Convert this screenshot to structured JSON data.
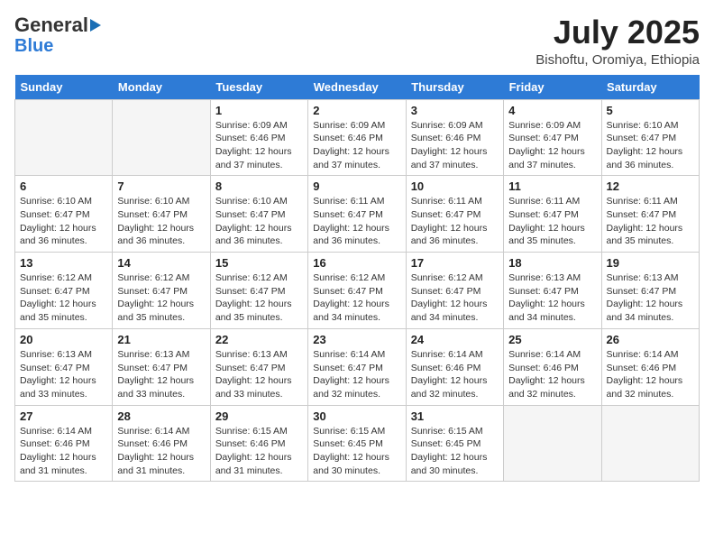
{
  "header": {
    "logo_line1": "General",
    "logo_line2": "Blue",
    "month_year": "July 2025",
    "location": "Bishoftu, Oromiya, Ethiopia"
  },
  "days_of_week": [
    "Sunday",
    "Monday",
    "Tuesday",
    "Wednesday",
    "Thursday",
    "Friday",
    "Saturday"
  ],
  "weeks": [
    [
      {
        "day": "",
        "info": ""
      },
      {
        "day": "",
        "info": ""
      },
      {
        "day": "1",
        "info": "Sunrise: 6:09 AM\nSunset: 6:46 PM\nDaylight: 12 hours and 37 minutes."
      },
      {
        "day": "2",
        "info": "Sunrise: 6:09 AM\nSunset: 6:46 PM\nDaylight: 12 hours and 37 minutes."
      },
      {
        "day": "3",
        "info": "Sunrise: 6:09 AM\nSunset: 6:46 PM\nDaylight: 12 hours and 37 minutes."
      },
      {
        "day": "4",
        "info": "Sunrise: 6:09 AM\nSunset: 6:47 PM\nDaylight: 12 hours and 37 minutes."
      },
      {
        "day": "5",
        "info": "Sunrise: 6:10 AM\nSunset: 6:47 PM\nDaylight: 12 hours and 36 minutes."
      }
    ],
    [
      {
        "day": "6",
        "info": "Sunrise: 6:10 AM\nSunset: 6:47 PM\nDaylight: 12 hours and 36 minutes."
      },
      {
        "day": "7",
        "info": "Sunrise: 6:10 AM\nSunset: 6:47 PM\nDaylight: 12 hours and 36 minutes."
      },
      {
        "day": "8",
        "info": "Sunrise: 6:10 AM\nSunset: 6:47 PM\nDaylight: 12 hours and 36 minutes."
      },
      {
        "day": "9",
        "info": "Sunrise: 6:11 AM\nSunset: 6:47 PM\nDaylight: 12 hours and 36 minutes."
      },
      {
        "day": "10",
        "info": "Sunrise: 6:11 AM\nSunset: 6:47 PM\nDaylight: 12 hours and 36 minutes."
      },
      {
        "day": "11",
        "info": "Sunrise: 6:11 AM\nSunset: 6:47 PM\nDaylight: 12 hours and 35 minutes."
      },
      {
        "day": "12",
        "info": "Sunrise: 6:11 AM\nSunset: 6:47 PM\nDaylight: 12 hours and 35 minutes."
      }
    ],
    [
      {
        "day": "13",
        "info": "Sunrise: 6:12 AM\nSunset: 6:47 PM\nDaylight: 12 hours and 35 minutes."
      },
      {
        "day": "14",
        "info": "Sunrise: 6:12 AM\nSunset: 6:47 PM\nDaylight: 12 hours and 35 minutes."
      },
      {
        "day": "15",
        "info": "Sunrise: 6:12 AM\nSunset: 6:47 PM\nDaylight: 12 hours and 35 minutes."
      },
      {
        "day": "16",
        "info": "Sunrise: 6:12 AM\nSunset: 6:47 PM\nDaylight: 12 hours and 34 minutes."
      },
      {
        "day": "17",
        "info": "Sunrise: 6:12 AM\nSunset: 6:47 PM\nDaylight: 12 hours and 34 minutes."
      },
      {
        "day": "18",
        "info": "Sunrise: 6:13 AM\nSunset: 6:47 PM\nDaylight: 12 hours and 34 minutes."
      },
      {
        "day": "19",
        "info": "Sunrise: 6:13 AM\nSunset: 6:47 PM\nDaylight: 12 hours and 34 minutes."
      }
    ],
    [
      {
        "day": "20",
        "info": "Sunrise: 6:13 AM\nSunset: 6:47 PM\nDaylight: 12 hours and 33 minutes."
      },
      {
        "day": "21",
        "info": "Sunrise: 6:13 AM\nSunset: 6:47 PM\nDaylight: 12 hours and 33 minutes."
      },
      {
        "day": "22",
        "info": "Sunrise: 6:13 AM\nSunset: 6:47 PM\nDaylight: 12 hours and 33 minutes."
      },
      {
        "day": "23",
        "info": "Sunrise: 6:14 AM\nSunset: 6:47 PM\nDaylight: 12 hours and 32 minutes."
      },
      {
        "day": "24",
        "info": "Sunrise: 6:14 AM\nSunset: 6:46 PM\nDaylight: 12 hours and 32 minutes."
      },
      {
        "day": "25",
        "info": "Sunrise: 6:14 AM\nSunset: 6:46 PM\nDaylight: 12 hours and 32 minutes."
      },
      {
        "day": "26",
        "info": "Sunrise: 6:14 AM\nSunset: 6:46 PM\nDaylight: 12 hours and 32 minutes."
      }
    ],
    [
      {
        "day": "27",
        "info": "Sunrise: 6:14 AM\nSunset: 6:46 PM\nDaylight: 12 hours and 31 minutes."
      },
      {
        "day": "28",
        "info": "Sunrise: 6:14 AM\nSunset: 6:46 PM\nDaylight: 12 hours and 31 minutes."
      },
      {
        "day": "29",
        "info": "Sunrise: 6:15 AM\nSunset: 6:46 PM\nDaylight: 12 hours and 31 minutes."
      },
      {
        "day": "30",
        "info": "Sunrise: 6:15 AM\nSunset: 6:45 PM\nDaylight: 12 hours and 30 minutes."
      },
      {
        "day": "31",
        "info": "Sunrise: 6:15 AM\nSunset: 6:45 PM\nDaylight: 12 hours and 30 minutes."
      },
      {
        "day": "",
        "info": ""
      },
      {
        "day": "",
        "info": ""
      }
    ]
  ]
}
